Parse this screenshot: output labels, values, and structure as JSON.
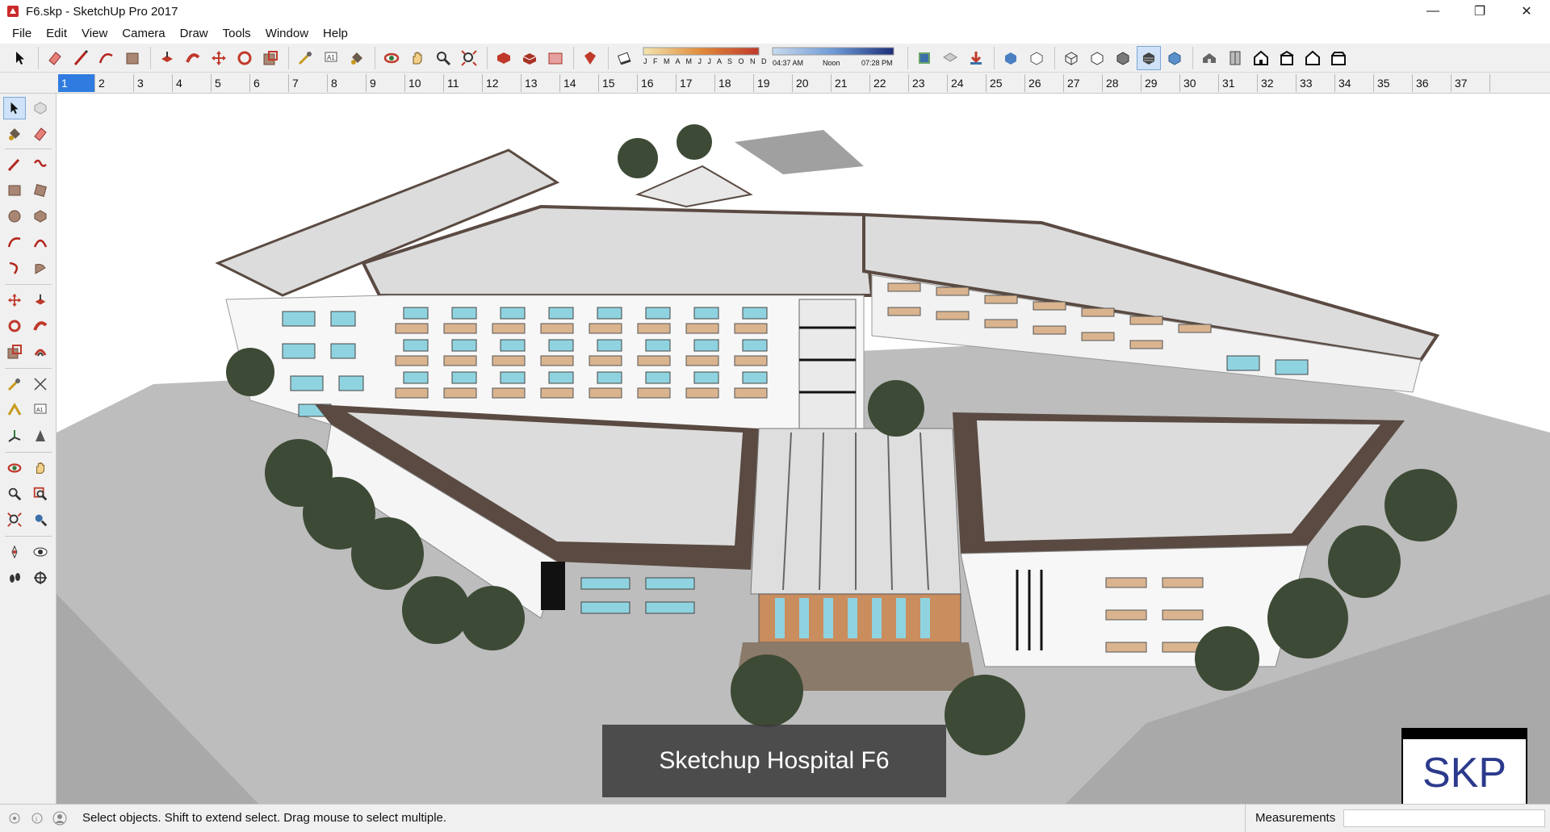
{
  "window": {
    "title": "F6.skp - SketchUp Pro 2017",
    "minimize_glyph": "—",
    "restore_glyph": "❐",
    "close_glyph": "✕"
  },
  "menu": [
    "File",
    "Edit",
    "View",
    "Camera",
    "Draw",
    "Tools",
    "Window",
    "Help"
  ],
  "toolbar": {
    "icons": [
      "select-icon",
      "eraser-icon",
      "line-icon",
      "arc-icon",
      "rectangle-icon",
      "push-pull-icon",
      "follow-me-icon",
      "move-icon",
      "rotate-icon",
      "scale-icon",
      "tape-measure-icon",
      "text-icon",
      "paint-bucket-icon",
      "orbit-icon",
      "pan-icon",
      "zoom-icon",
      "zoom-extents-icon",
      "3d-warehouse-icon",
      "extension-warehouse-icon",
      "layout-icon",
      "ruby-icon",
      "shadow-toggle-icon"
    ],
    "shadow_months": "J F M A M J J A S O N D",
    "shadow_time_start": "04:37 AM",
    "shadow_time_mid": "Noon",
    "shadow_time_end": "07:28 PM",
    "icons_right": [
      "geo-location-icon",
      "add-location-icon",
      "download-icon",
      "xray-icon",
      "back-edges-icon",
      "wireframe-icon",
      "hidden-line-icon",
      "shaded-icon",
      "shaded-textures-icon",
      "monochrome-icon",
      "iso-view-icon",
      "top-view-icon",
      "front-view-icon",
      "right-view-icon",
      "back-view-icon",
      "left-view-icon"
    ]
  },
  "scenes": [
    "1",
    "2",
    "3",
    "4",
    "5",
    "6",
    "7",
    "8",
    "9",
    "10",
    "11",
    "12",
    "13",
    "14",
    "15",
    "16",
    "17",
    "18",
    "19",
    "20",
    "21",
    "22",
    "23",
    "24",
    "25",
    "26",
    "27",
    "28",
    "29",
    "30",
    "31",
    "32",
    "33",
    "34",
    "35",
    "36",
    "37"
  ],
  "active_scene": "1",
  "viewport": {
    "caption": "Sketchup Hospital F6",
    "logo": "SKP"
  },
  "status": {
    "message": "Select objects. Shift to extend select. Drag mouse to select multiple.",
    "measurements_label": "Measurements",
    "measurements_value": ""
  },
  "colors": {
    "accent": "#2f7bdf",
    "roof": "#dcdcdc",
    "roof_edge": "#5a4a42",
    "facade": "#f7f7f7",
    "window": "#8fd3e0",
    "balcony": "#d9b48f",
    "ground": "#bdbdbd",
    "tree": "#3d4a35"
  }
}
